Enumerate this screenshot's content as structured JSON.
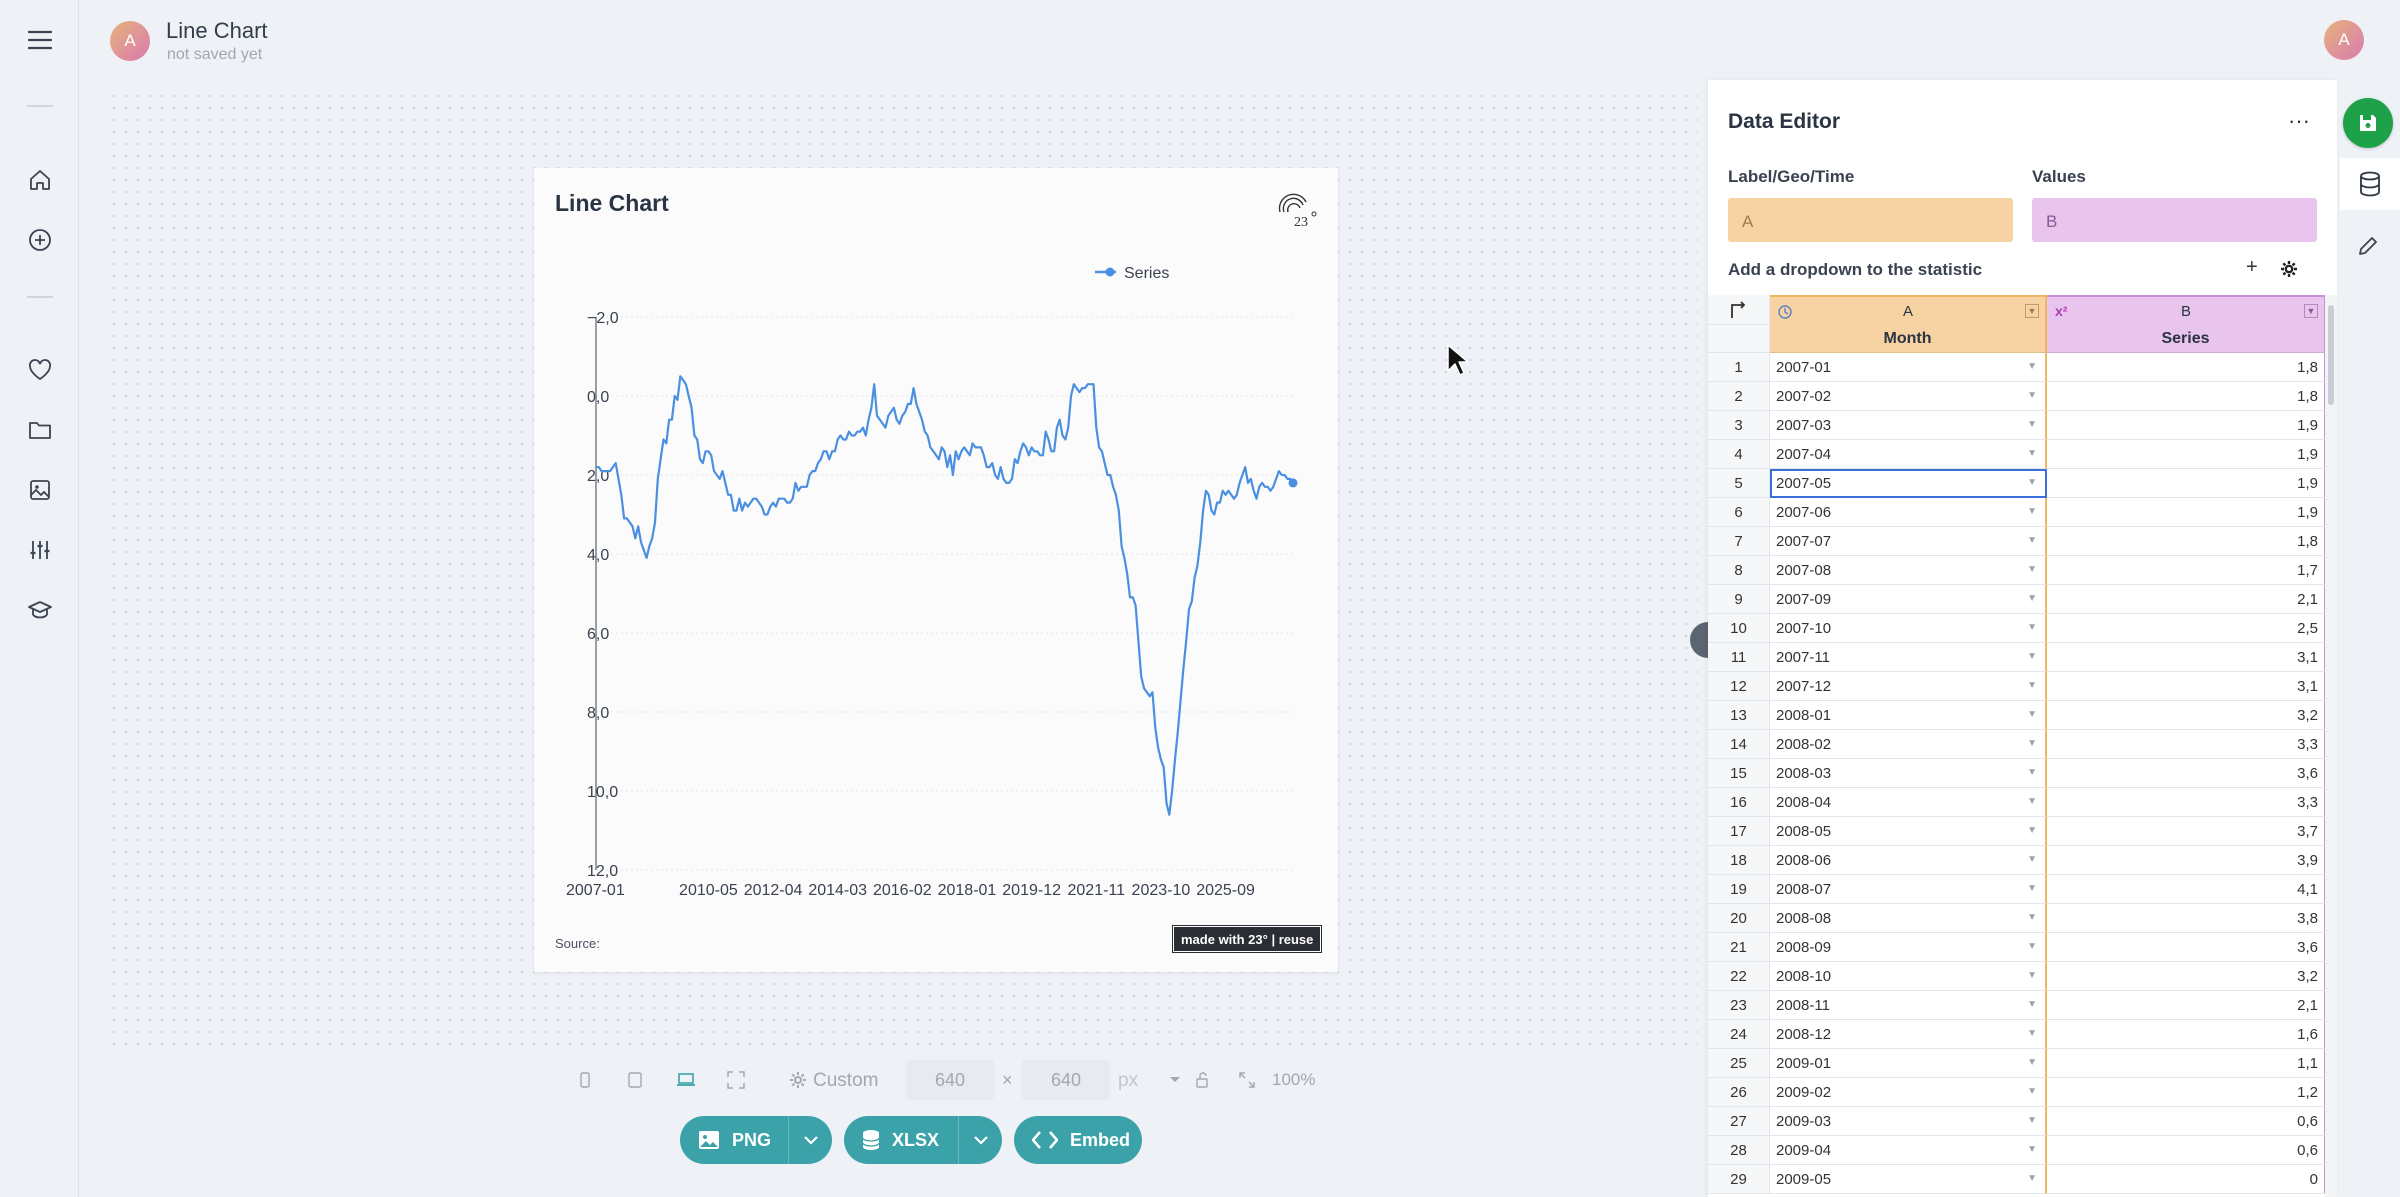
{
  "header": {
    "title": "Line Chart",
    "status": "not saved yet",
    "avatar_initial": "A",
    "user_initial": "A"
  },
  "nav": {
    "icons": [
      "menu-icon",
      "home-icon",
      "add-circle-icon",
      "heart-icon",
      "folder-icon",
      "image-icon",
      "sliders-icon",
      "graduation-cap-icon"
    ]
  },
  "chart": {
    "title": "Line Chart",
    "legend_label": "Series",
    "source_label": "Source:",
    "badge_text": "made with 23° | reuse",
    "line_color": "#4a8fe0"
  },
  "chart_data": {
    "type": "line",
    "title": "Line Chart",
    "series": [
      {
        "name": "Series",
        "values": [
          1.8,
          1.8,
          1.9,
          1.9,
          1.9,
          1.9,
          1.8,
          1.7,
          2.1,
          2.5,
          3.1,
          3.1,
          3.2,
          3.3,
          3.6,
          3.3,
          3.7,
          3.9,
          4.1,
          3.8,
          3.6,
          3.2,
          2.1,
          1.6,
          1.1,
          1.2,
          0.6,
          0.6,
          0.0,
          0.1,
          -0.5,
          -0.4,
          -0.3,
          0.0,
          0.3,
          1.0,
          1.1,
          1.6,
          1.7,
          1.4,
          1.4,
          1.5,
          1.9,
          2.0,
          2.1,
          1.9,
          2.2,
          2.5,
          2.5,
          2.9,
          2.9,
          2.6,
          2.9,
          2.7,
          2.8,
          2.7,
          2.6,
          2.6,
          2.7,
          2.8,
          3.0,
          3.0,
          2.8,
          2.7,
          2.8,
          2.6,
          2.6,
          2.6,
          2.7,
          2.7,
          2.6,
          2.2,
          2.4,
          2.3,
          2.3,
          2.3,
          2.0,
          1.9,
          1.9,
          1.7,
          1.6,
          1.4,
          1.4,
          1.6,
          1.4,
          1.4,
          1.1,
          1.0,
          1.1,
          1.1,
          0.9,
          1.0,
          1.0,
          0.9,
          0.9,
          0.8,
          1.0,
          0.6,
          0.3,
          -0.3,
          0.5,
          0.6,
          0.7,
          0.8,
          0.5,
          0.4,
          0.3,
          0.6,
          0.7,
          0.5,
          0.4,
          0.2,
          0.2,
          -0.2,
          0.2,
          0.4,
          0.6,
          0.9,
          1.0,
          1.3,
          1.4,
          1.5,
          1.6,
          1.3,
          1.4,
          1.8,
          1.5,
          2.0,
          1.4,
          1.6,
          1.4,
          1.3,
          1.4,
          1.5,
          1.2,
          1.3,
          1.3,
          1.3,
          1.5,
          1.8,
          1.8,
          1.7,
          2.0,
          2.1,
          1.8,
          2.1,
          2.2,
          2.2,
          2.1,
          1.6,
          1.7,
          1.4,
          1.2,
          1.3,
          1.5,
          1.3,
          1.4,
          1.4,
          1.5,
          1.5,
          0.9,
          1.1,
          1.4,
          1.4,
          0.8,
          0.6,
          1.0,
          1.1,
          0.8,
          0.0,
          -0.3,
          -0.2,
          -0.1,
          -0.2,
          -0.2,
          -0.3,
          -0.3,
          -0.3,
          0.8,
          1.3,
          1.4,
          1.7,
          2.0,
          2.0,
          2.3,
          2.5,
          2.9,
          3.8,
          4.1,
          4.5,
          5.1,
          5.1,
          5.3,
          6.2,
          7.1,
          7.4,
          7.5,
          7.6,
          7.5,
          8.4,
          8.9,
          9.2,
          9.4,
          10.3,
          10.6,
          10.0,
          9.2,
          8.5,
          7.7,
          6.9,
          6.2,
          5.4,
          5.2,
          4.6,
          4.3,
          3.7,
          2.9,
          2.4,
          2.5,
          2.9,
          3.0,
          2.7,
          2.7,
          2.4,
          2.5,
          2.4,
          2.5,
          2.6,
          2.5,
          2.2,
          2.0,
          1.8,
          2.2,
          2.1,
          2.4,
          2.6,
          2.3,
          2.2,
          2.3,
          2.3,
          2.4,
          2.3,
          2.1,
          1.9,
          2.0,
          2.0,
          2.1,
          2.1,
          2.2
        ]
      }
    ],
    "x_tick_labels": [
      "2007-01",
      "2010-05",
      "2012-04",
      "2014-03",
      "2016-02",
      "2018-01",
      "2019-12",
      "2021-11",
      "2023-10",
      "2025-09"
    ],
    "y_tick_labels": [
      "−2,0",
      "0,0",
      "2,0",
      "4,0",
      "6,0",
      "8,0",
      "10,0",
      "12,0"
    ],
    "xlabel": "",
    "ylabel": "",
    "ylim": [
      12,
      -2
    ],
    "y_reversed": true,
    "grid": true,
    "legend": "top-left"
  },
  "toolbar": {
    "size_preset": "Custom",
    "width": "640",
    "height": "640",
    "times": "×",
    "unit": "px",
    "zoom": "100%"
  },
  "export": {
    "png_label": "PNG",
    "xlsx_label": "XLSX",
    "embed_label": "Embed"
  },
  "editor": {
    "title": "Data Editor",
    "more_label": "···",
    "label_field_label": "Label/Geo/Time",
    "label_field_value": "A",
    "values_field_label": "Values",
    "values_field_value": "B",
    "dropdown_text": "Add a dropdown to the statistic",
    "add_label": "+",
    "col_a_letter": "A",
    "col_b_letter": "B",
    "col_a_name": "Month",
    "col_b_name": "Series",
    "col_b_type": "x²",
    "rows": [
      [
        "1",
        "2007-01",
        "1,8"
      ],
      [
        "2",
        "2007-02",
        "1,8"
      ],
      [
        "3",
        "2007-03",
        "1,9"
      ],
      [
        "4",
        "2007-04",
        "1,9"
      ],
      [
        "5",
        "2007-05",
        "1,9"
      ],
      [
        "6",
        "2007-06",
        "1,9"
      ],
      [
        "7",
        "2007-07",
        "1,8"
      ],
      [
        "8",
        "2007-08",
        "1,7"
      ],
      [
        "9",
        "2007-09",
        "2,1"
      ],
      [
        "10",
        "2007-10",
        "2,5"
      ],
      [
        "11",
        "2007-11",
        "3,1"
      ],
      [
        "12",
        "2007-12",
        "3,1"
      ],
      [
        "13",
        "2008-01",
        "3,2"
      ],
      [
        "14",
        "2008-02",
        "3,3"
      ],
      [
        "15",
        "2008-03",
        "3,6"
      ],
      [
        "16",
        "2008-04",
        "3,3"
      ],
      [
        "17",
        "2008-05",
        "3,7"
      ],
      [
        "18",
        "2008-06",
        "3,9"
      ],
      [
        "19",
        "2008-07",
        "4,1"
      ],
      [
        "20",
        "2008-08",
        "3,8"
      ],
      [
        "21",
        "2008-09",
        "3,6"
      ],
      [
        "22",
        "2008-10",
        "3,2"
      ],
      [
        "23",
        "2008-11",
        "2,1"
      ],
      [
        "24",
        "2008-12",
        "1,6"
      ],
      [
        "25",
        "2009-01",
        "1,1"
      ],
      [
        "26",
        "2009-02",
        "1,2"
      ],
      [
        "27",
        "2009-03",
        "0,6"
      ],
      [
        "28",
        "2009-04",
        "0,6"
      ],
      [
        "29",
        "2009-05",
        "0"
      ]
    ],
    "selected_row": 4
  },
  "colors": {
    "accent_teal": "#3aa2a8",
    "save_green": "#1fa14a",
    "label_col": "#f7d3a4",
    "values_col": "#e9c4ec"
  }
}
